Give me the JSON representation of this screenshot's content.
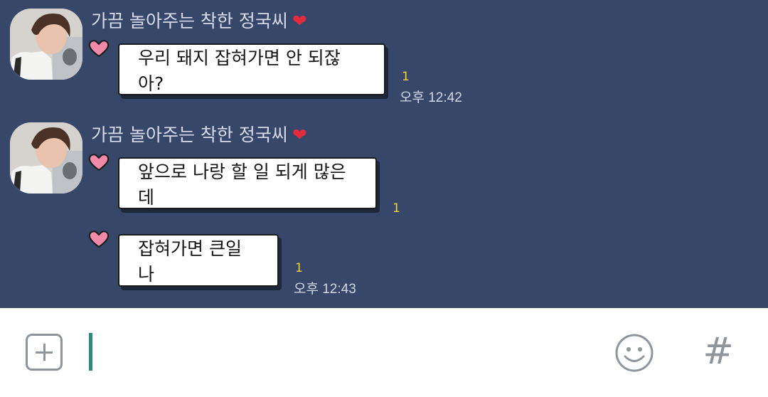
{
  "chat": {
    "sender_name": "가끔 놀아주는 착한 정국씨",
    "sender_heart": "❤",
    "messages": [
      {
        "text": "우리 돼지 잡혀가면 안 되잖아?",
        "read_count": "1",
        "time": "오후 12:42"
      },
      {
        "text": "앞으로 나랑 할 일 되게 많은데",
        "read_count": "1",
        "time": ""
      },
      {
        "text": "잡혀가면 큰일 나",
        "read_count": "1",
        "time": "오후 12:43"
      }
    ]
  },
  "input_bar": {
    "hash_label": "#",
    "icons": {
      "add": "plus-square-icon",
      "emoji": "smiley-icon",
      "hash": "hash-icon"
    }
  },
  "colors": {
    "chat_background": "#36476a",
    "read_count": "#f2d23a",
    "caret": "#1f8f7e",
    "heart": "#e02c3c"
  }
}
